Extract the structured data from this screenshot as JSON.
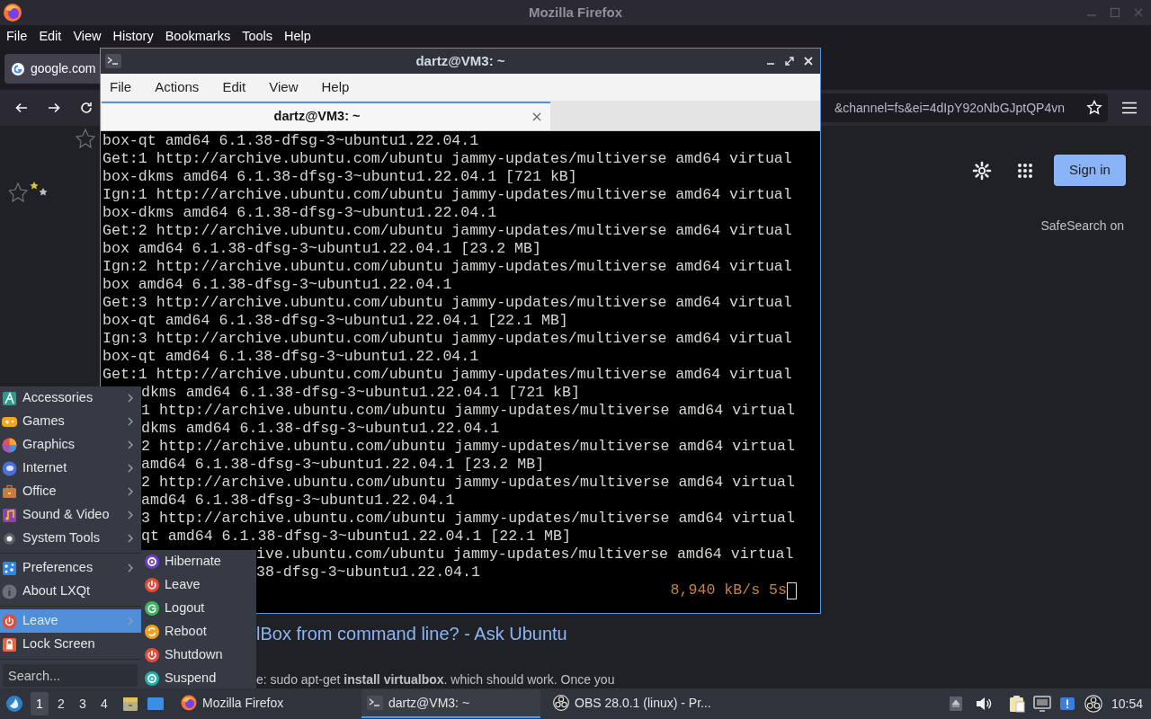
{
  "firefox": {
    "title": "Mozilla Firefox",
    "menu": [
      "File",
      "Edit",
      "View",
      "History",
      "Bookmarks",
      "Tools",
      "Help"
    ],
    "tab": {
      "label": "google.com"
    },
    "url": "&channel=fs&ei=4dIpY92oNbGJptQP4vn",
    "page": {
      "sign_in": "Sign in",
      "safesearch": "SafeSearch on",
      "result_title": "lBox from command line? - Ask Ubuntu",
      "result_snippet": "e: sudo apt-get **install virtualbox**. which should work. Once you"
    }
  },
  "terminal": {
    "title": "dartz@VM3: ~",
    "menu": [
      "File",
      "Actions",
      "Edit",
      "View",
      "Help"
    ],
    "tabs": [
      {
        "label": "dartz@VM3: ~",
        "selected": true
      }
    ],
    "lines": [
      {
        "text": "box-qt amd64 6.1.38-dfsg-3~ubuntu1.22.04.1",
        "kind": "full"
      },
      {
        "text": "Get:1 http://archive.ubuntu.com/ubuntu jammy-updates/multiverse amd64 virtual",
        "kind": "full"
      },
      {
        "text": "box-dkms amd64 6.1.38-dfsg-3~ubuntu1.22.04.1 [721 kB]",
        "kind": "full"
      },
      {
        "text": "Ign:1 http://archive.ubuntu.com/ubuntu jammy-updates/multiverse amd64 virtual",
        "kind": "full"
      },
      {
        "text": "box-dkms amd64 6.1.38-dfsg-3~ubuntu1.22.04.1",
        "kind": "full"
      },
      {
        "text": "Get:2 http://archive.ubuntu.com/ubuntu jammy-updates/multiverse amd64 virtual",
        "kind": "full"
      },
      {
        "text": "box amd64 6.1.38-dfsg-3~ubuntu1.22.04.1 [23.2 MB]",
        "kind": "full"
      },
      {
        "text": "Ign:2 http://archive.ubuntu.com/ubuntu jammy-updates/multiverse amd64 virtual",
        "kind": "full"
      },
      {
        "text": "box amd64 6.1.38-dfsg-3~ubuntu1.22.04.1",
        "kind": "full"
      },
      {
        "text": "Get:3 http://archive.ubuntu.com/ubuntu jammy-updates/multiverse amd64 virtual",
        "kind": "full"
      },
      {
        "text": "box-qt amd64 6.1.38-dfsg-3~ubuntu1.22.04.1 [22.1 MB]",
        "kind": "full"
      },
      {
        "text": "Ign:3 http://archive.ubuntu.com/ubuntu jammy-updates/multiverse amd64 virtual",
        "kind": "full"
      },
      {
        "text": "box-qt amd64 6.1.38-dfsg-3~ubuntu1.22.04.1",
        "kind": "full"
      },
      {
        "text": "Get:1 http://archive.ubuntu.com/ubuntu jammy-updates/multiverse amd64 virtual",
        "kind": "full"
      },
      {
        "text": "dkms amd64 6.1.38-dfsg-3~ubuntu1.22.04.1 [721 kB]",
        "kind": "under_menu"
      },
      {
        "text": "1 http://archive.ubuntu.com/ubuntu jammy-updates/multiverse amd64 virtual",
        "kind": "under_menu"
      },
      {
        "text": "dkms amd64 6.1.38-dfsg-3~ubuntu1.22.04.1",
        "kind": "under_menu"
      },
      {
        "text": "2 http://archive.ubuntu.com/ubuntu jammy-updates/multiverse amd64 virtual",
        "kind": "under_menu"
      },
      {
        "text": "amd64 6.1.38-dfsg-3~ubuntu1.22.04.1 [23.2 MB]",
        "kind": "under_menu"
      },
      {
        "text": "2 http://archive.ubuntu.com/ubuntu jammy-updates/multiverse amd64 virtual",
        "kind": "under_menu"
      },
      {
        "text": "amd64 6.1.38-dfsg-3~ubuntu1.22.04.1",
        "kind": "under_menu"
      },
      {
        "text": "3 http://archive.ubuntu.com/ubuntu jammy-updates/multiverse amd64 virtual",
        "kind": "under_menu"
      },
      {
        "text": "qt amd64 6.1.38-dfsg-3~ubuntu1.22.04.1 [22.1 MB]",
        "kind": "under_menu"
      },
      {
        "text": "ive.ubuntu.com/ubuntu jammy-updates/multiverse amd64 virtual",
        "kind": "under_submenu"
      },
      {
        "text": "38-dfsg-3~ubuntu1.22.04.1",
        "kind": "under_submenu"
      }
    ],
    "status": "8,940 kB/s 5s"
  },
  "start_menu": {
    "groups": [
      {
        "items": [
          {
            "label": "Accessories",
            "has_submenu": true,
            "selected": false
          },
          {
            "label": "Games",
            "has_submenu": true,
            "selected": false
          },
          {
            "label": "Graphics",
            "has_submenu": true,
            "selected": false
          },
          {
            "label": "Internet",
            "has_submenu": true,
            "selected": false
          },
          {
            "label": "Office",
            "has_submenu": true,
            "selected": false
          },
          {
            "label": "Sound & Video",
            "has_submenu": true,
            "selected": false
          },
          {
            "label": "System Tools",
            "has_submenu": true,
            "selected": false
          }
        ]
      },
      {
        "items": [
          {
            "label": "Preferences",
            "has_submenu": true,
            "selected": false
          },
          {
            "label": "About LXQt",
            "has_submenu": false,
            "selected": false
          }
        ]
      },
      {
        "items": [
          {
            "label": "Leave",
            "has_submenu": true,
            "selected": true
          },
          {
            "label": "Lock Screen",
            "has_submenu": false,
            "selected": false
          }
        ]
      }
    ],
    "search": {
      "placeholder": "Search..."
    }
  },
  "leave_menu": {
    "items": [
      "Hibernate",
      "Leave",
      "Logout",
      "Reboot",
      "Shutdown",
      "Suspend"
    ]
  },
  "taskbar": {
    "desktops": [
      {
        "label": "1",
        "selected": true
      },
      {
        "label": "2",
        "selected": false
      },
      {
        "label": "3",
        "selected": false
      },
      {
        "label": "4",
        "selected": false
      }
    ],
    "tasks": [
      {
        "label": "Mozilla Firefox",
        "selected": false
      },
      {
        "label": "dartz@VM3: ~",
        "selected": true
      },
      {
        "label": "OBS 28.0.1 (linux) - Pr...",
        "selected": false
      }
    ],
    "clock": "10:54"
  }
}
